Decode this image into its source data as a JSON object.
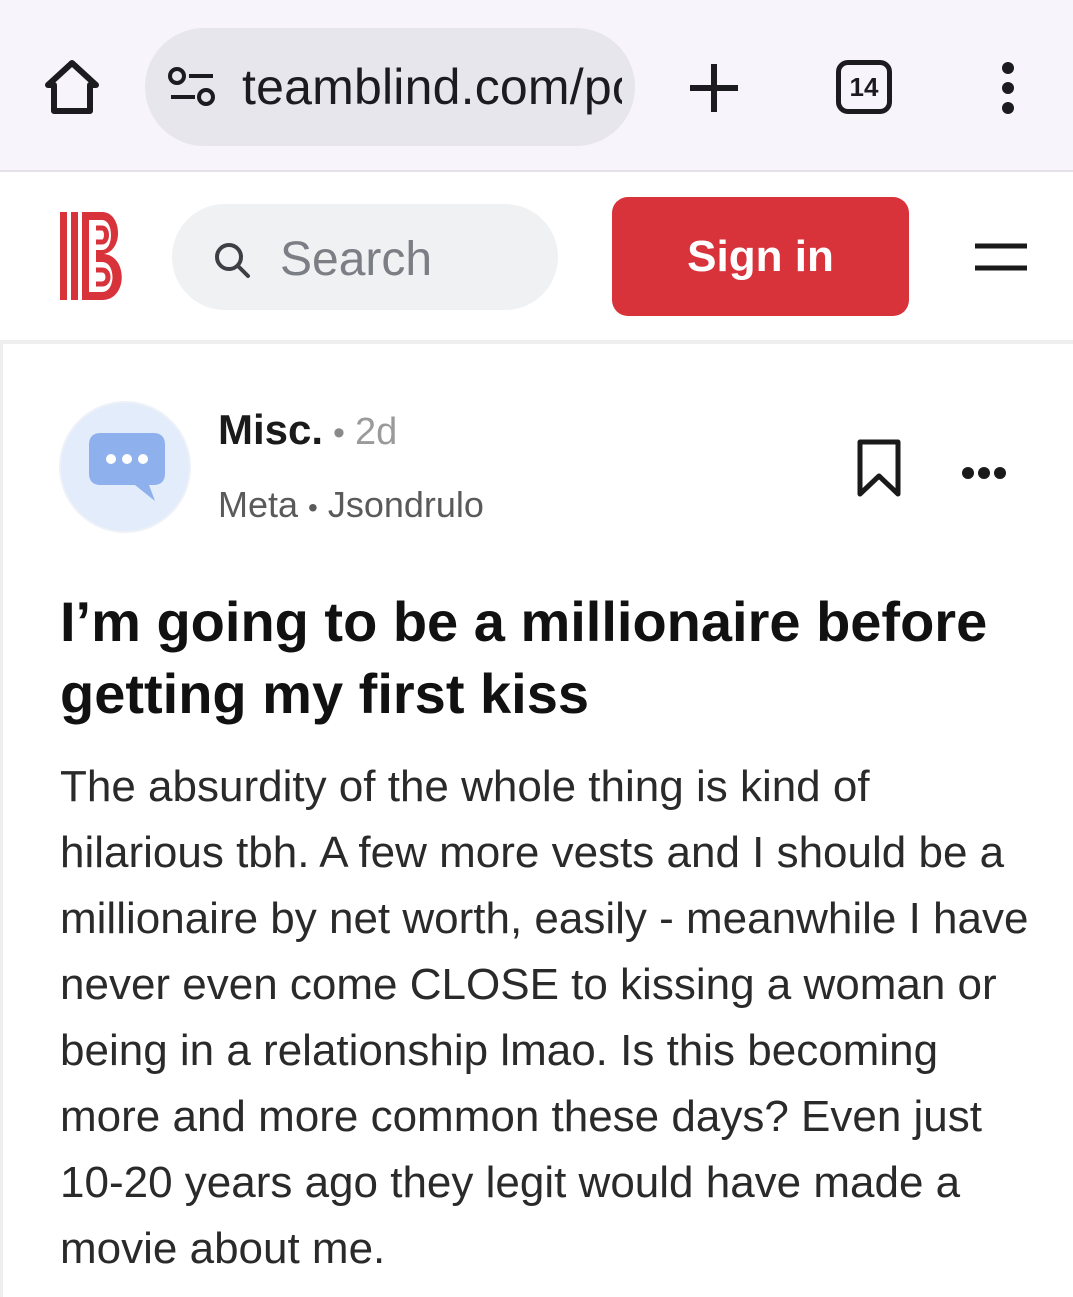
{
  "browser": {
    "url": "teamblind.com/po",
    "tab_count": "14",
    "icons": [
      "home-icon",
      "site-info-icon",
      "new-tab-icon",
      "tab-switcher-icon",
      "more-vert-icon"
    ]
  },
  "header": {
    "search_placeholder": "Search",
    "signin_label": "Sign in",
    "brand_color": "#d8323b",
    "icons": [
      "blind-logo-icon",
      "search-icon",
      "hamburger-menu-icon"
    ]
  },
  "post": {
    "channel": "Misc.",
    "separator": "•",
    "age": "2d",
    "company": "Meta",
    "author": "Jsondrulo",
    "title": "I’m going to be a millionaire before getting my first kiss",
    "body": "The absurdity of the whole thing is kind of hilarious tbh. A few more vests and I should be a millionaire by net worth, easily - meanwhile I have never even come CLOSE to kissing a woman or being in a relationship lmao. Is this becoming more and more common these days? Even just 10-20 years ago they legit would have made a movie about me.",
    "icons": [
      "chat-bubble-icon",
      "bookmark-icon",
      "more-horiz-icon"
    ]
  }
}
